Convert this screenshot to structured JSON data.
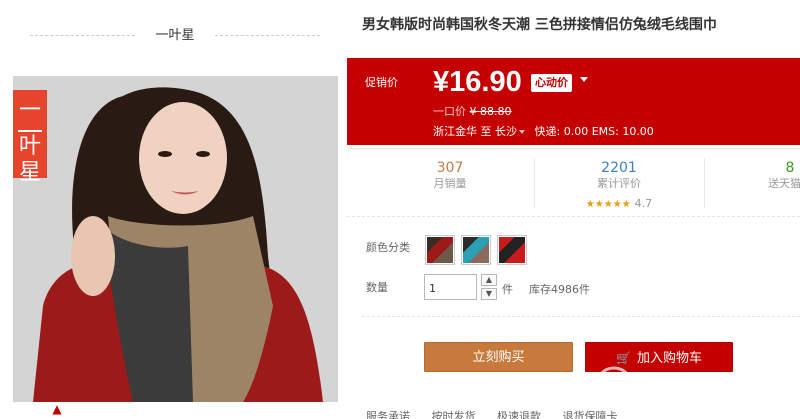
{
  "shop": {
    "name": "一叶星"
  },
  "product": {
    "title": "男女韩版时尚韩国秋冬天潮  三色拼接情侣仿兔绒毛线围巾",
    "brand_tag": [
      "一",
      "叶",
      "星"
    ]
  },
  "price": {
    "label": "促销价",
    "current": "¥16.90",
    "badge": "心动价",
    "original_label": "一口价",
    "original_value": "¥ 88.80",
    "ship_from": "浙江金华",
    "ship_to_prefix": "至",
    "ship_to": "长沙",
    "shipping": "快递: 0.00 EMS: 10.00"
  },
  "stats": [
    {
      "value": "307",
      "label": "月销量"
    },
    {
      "value": "2201",
      "label": "累计评价",
      "stars": "★★★★★",
      "rating": "4.7"
    },
    {
      "value": "8",
      "label": "送天猫积"
    }
  ],
  "options": {
    "color_label": "颜色分类",
    "quantity_label": "数量",
    "quantity_value": "1",
    "unit": "件",
    "stock": "库存4986件"
  },
  "actions": {
    "buy_now": "立刻购买",
    "add_to_cart": "加入购物车"
  },
  "services": [
    "服务承诺",
    "按时发货",
    "极速退款",
    "退货保障卡"
  ],
  "colors": {
    "accent": "#c40000",
    "buy_button": "#c77a3c",
    "brand_tag": "#e6452d"
  },
  "icons": [
    "chevron-up-icon",
    "cart-icon",
    "caret-down-icon"
  ]
}
